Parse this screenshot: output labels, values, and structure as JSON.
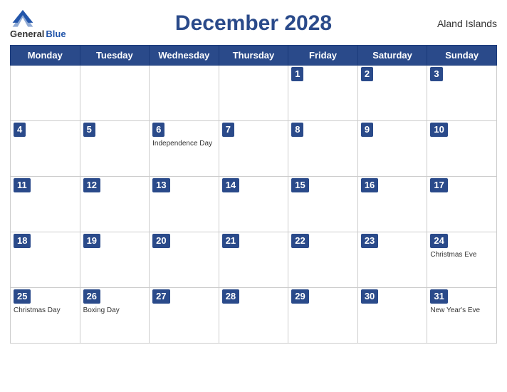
{
  "header": {
    "title": "December 2028",
    "region": "Aland Islands",
    "logo_general": "General",
    "logo_blue": "Blue"
  },
  "days_of_week": [
    "Monday",
    "Tuesday",
    "Wednesday",
    "Thursday",
    "Friday",
    "Saturday",
    "Sunday"
  ],
  "weeks": [
    [
      {
        "day": null,
        "holiday": null
      },
      {
        "day": null,
        "holiday": null
      },
      {
        "day": null,
        "holiday": null
      },
      {
        "day": null,
        "holiday": null
      },
      {
        "day": "1",
        "holiday": null
      },
      {
        "day": "2",
        "holiday": null
      },
      {
        "day": "3",
        "holiday": null
      }
    ],
    [
      {
        "day": "4",
        "holiday": null
      },
      {
        "day": "5",
        "holiday": null
      },
      {
        "day": "6",
        "holiday": "Independence Day"
      },
      {
        "day": "7",
        "holiday": null
      },
      {
        "day": "8",
        "holiday": null
      },
      {
        "day": "9",
        "holiday": null
      },
      {
        "day": "10",
        "holiday": null
      }
    ],
    [
      {
        "day": "11",
        "holiday": null
      },
      {
        "day": "12",
        "holiday": null
      },
      {
        "day": "13",
        "holiday": null
      },
      {
        "day": "14",
        "holiday": null
      },
      {
        "day": "15",
        "holiday": null
      },
      {
        "day": "16",
        "holiday": null
      },
      {
        "day": "17",
        "holiday": null
      }
    ],
    [
      {
        "day": "18",
        "holiday": null
      },
      {
        "day": "19",
        "holiday": null
      },
      {
        "day": "20",
        "holiday": null
      },
      {
        "day": "21",
        "holiday": null
      },
      {
        "day": "22",
        "holiday": null
      },
      {
        "day": "23",
        "holiday": null
      },
      {
        "day": "24",
        "holiday": "Christmas Eve"
      }
    ],
    [
      {
        "day": "25",
        "holiday": "Christmas Day"
      },
      {
        "day": "26",
        "holiday": "Boxing Day"
      },
      {
        "day": "27",
        "holiday": null
      },
      {
        "day": "28",
        "holiday": null
      },
      {
        "day": "29",
        "holiday": null
      },
      {
        "day": "30",
        "holiday": null
      },
      {
        "day": "31",
        "holiday": "New Year's Eve"
      }
    ]
  ]
}
